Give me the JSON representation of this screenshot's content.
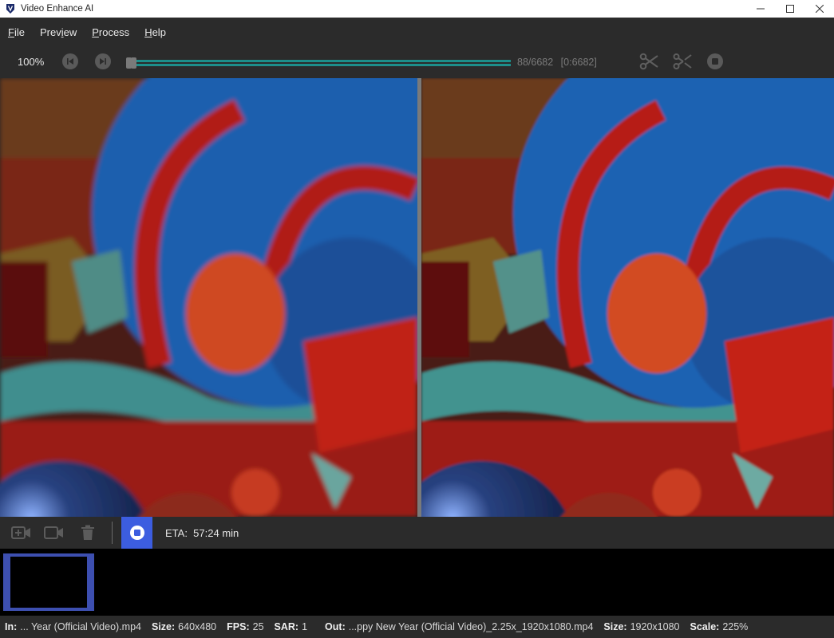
{
  "window": {
    "title": "Video Enhance AI",
    "controls": [
      "minimize",
      "maximize",
      "close"
    ]
  },
  "menu": [
    {
      "label": "File"
    },
    {
      "label": "Preview"
    },
    {
      "label": "Process"
    },
    {
      "label": "Help"
    }
  ],
  "toolbar": {
    "zoom": "100%",
    "frame_counter": "88/6682",
    "frame_range": "[0:6682]",
    "progress_fraction": 0.013,
    "icons": {
      "prev": "skip-back-icon",
      "next": "skip-forward-icon",
      "cut": "scissors-icon",
      "split": "split-icon",
      "stop": "stop-icon"
    }
  },
  "process_bar": {
    "eta_label": "ETA:",
    "eta_value": "57:24 min",
    "icons": [
      "add-video-icon",
      "video-camera-icon",
      "trash-icon",
      "stop-icon"
    ]
  },
  "status": {
    "in_label": "In:",
    "in_value": "... Year (Official Video).mp4",
    "in_size_label": "Size:",
    "in_size_value": "640x480",
    "fps_label": "FPS:",
    "fps_value": "25",
    "sar_label": "SAR:",
    "sar_value": "1",
    "out_label": "Out:",
    "out_value": "...ppy New Year (Official Video)_2.25x_1920x1080.mp4",
    "out_size_label": "Size:",
    "out_size_value": "1920x1080",
    "scale_label": "Scale:",
    "scale_value": "225%"
  },
  "colors": {
    "accent": "#3c5de0",
    "progress": "#1d8f8b",
    "panel": "#2b2b2b"
  }
}
